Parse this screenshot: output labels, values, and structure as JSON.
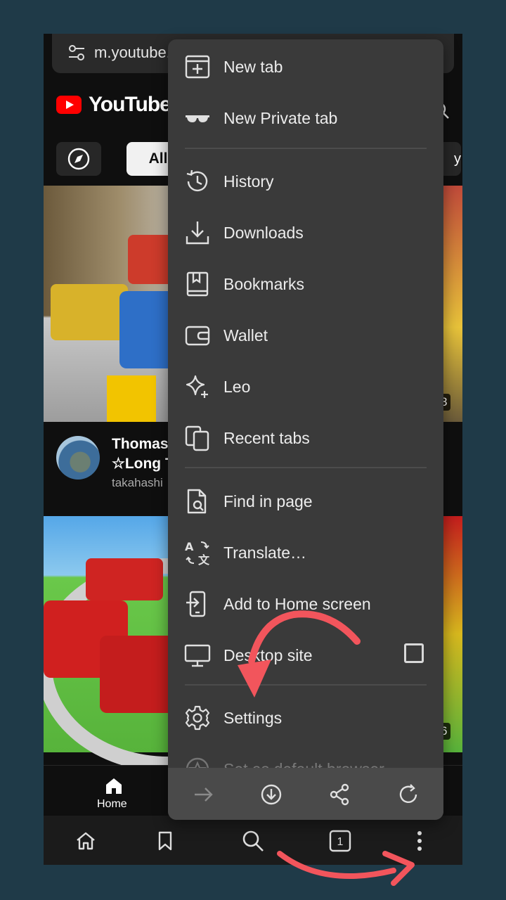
{
  "browser": {
    "url": "m.youtube.",
    "tab_count": "1"
  },
  "youtube": {
    "logo_text": "YouTube",
    "chips": {
      "all": "All",
      "right_partial": "y"
    },
    "videos": [
      {
        "title_line1": "Thomas",
        "title_line2": "☆Long T",
        "channel": "takahashi",
        "duration_partial": "8"
      },
      {
        "duration_partial": "6"
      }
    ],
    "nav": {
      "home": "Home"
    }
  },
  "menu": {
    "items": [
      {
        "label": "New tab",
        "icon": "new-tab-icon"
      },
      {
        "label": "New Private tab",
        "icon": "private-glasses-icon"
      },
      {
        "label": "History",
        "icon": "history-icon"
      },
      {
        "label": "Downloads",
        "icon": "download-icon"
      },
      {
        "label": "Bookmarks",
        "icon": "bookmarks-icon"
      },
      {
        "label": "Wallet",
        "icon": "wallet-icon"
      },
      {
        "label": "Leo",
        "icon": "leo-sparkle-icon"
      },
      {
        "label": "Recent tabs",
        "icon": "recent-tabs-icon"
      },
      {
        "label": "Find in page",
        "icon": "find-in-page-icon"
      },
      {
        "label": "Translate…",
        "icon": "translate-icon"
      },
      {
        "label": "Add to Home screen",
        "icon": "add-home-icon"
      },
      {
        "label": "Desktop site",
        "icon": "desktop-icon",
        "checked": false
      },
      {
        "label": "Settings",
        "icon": "settings-gear-icon"
      },
      {
        "label": "Set as default browser",
        "icon": "default-browser-icon"
      }
    ],
    "bottom_actions": [
      "forward-icon",
      "download-page-icon",
      "share-icon",
      "reload-icon"
    ]
  },
  "colors": {
    "background": "#1f3a48",
    "menu_bg": "#3a3a3a",
    "annotation_arrow": "#f2555c",
    "youtube_red": "#ff0000"
  }
}
